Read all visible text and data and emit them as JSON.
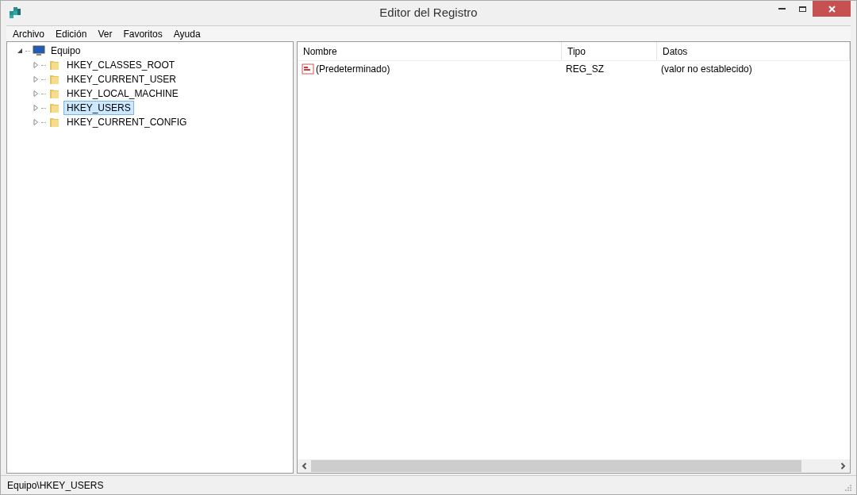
{
  "window": {
    "title": "Editor del Registro"
  },
  "menu": [
    "Archivo",
    "Edición",
    "Ver",
    "Favoritos",
    "Ayuda"
  ],
  "tree": [
    {
      "label": "Equipo",
      "kind": "computer",
      "expanded": true,
      "selected": false,
      "children": [
        {
          "label": "HKEY_CLASSES_ROOT",
          "kind": "folder",
          "expanded": false,
          "selected": false
        },
        {
          "label": "HKEY_CURRENT_USER",
          "kind": "folder",
          "expanded": false,
          "selected": false
        },
        {
          "label": "HKEY_LOCAL_MACHINE",
          "kind": "folder",
          "expanded": false,
          "selected": false
        },
        {
          "label": "HKEY_USERS",
          "kind": "folder",
          "expanded": false,
          "selected": true
        },
        {
          "label": "HKEY_CURRENT_CONFIG",
          "kind": "folder",
          "expanded": false,
          "selected": false
        }
      ]
    }
  ],
  "table": {
    "columns": [
      "Nombre",
      "Tipo",
      "Datos"
    ],
    "rows": [
      {
        "cells": [
          "(Predeterminado)",
          "REG_SZ",
          "(valor no establecido)"
        ]
      }
    ]
  },
  "status_bar": "Equipo\\HKEY_USERS"
}
